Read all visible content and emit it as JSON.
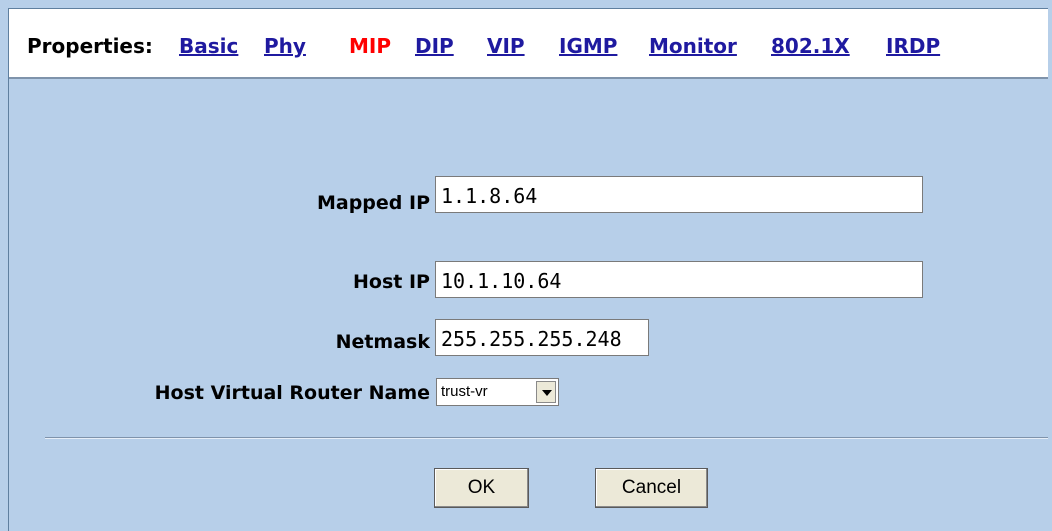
{
  "tabs": {
    "title": "Properties:",
    "items": [
      {
        "label": "Basic",
        "active": false
      },
      {
        "label": "Phy",
        "active": false
      },
      {
        "label": "MIP",
        "active": true
      },
      {
        "label": "DIP",
        "active": false
      },
      {
        "label": "VIP",
        "active": false
      },
      {
        "label": "IGMP",
        "active": false
      },
      {
        "label": "Monitor",
        "active": false
      },
      {
        "label": "802.1X",
        "active": false
      },
      {
        "label": "IRDP",
        "active": false
      }
    ]
  },
  "form": {
    "mapped_ip": {
      "label": "Mapped IP",
      "value": "1.1.8.64"
    },
    "host_ip": {
      "label": "Host IP",
      "value": "10.1.10.64"
    },
    "netmask": {
      "label": "Netmask",
      "value": "255.255.255.248"
    },
    "host_vr": {
      "label": "Host Virtual Router Name",
      "value": "trust-vr"
    }
  },
  "buttons": {
    "ok": "OK",
    "cancel": "Cancel"
  },
  "colors": {
    "background": "#b7cfe9",
    "link": "#1f1aa0",
    "active_tab": "#ff0000"
  }
}
